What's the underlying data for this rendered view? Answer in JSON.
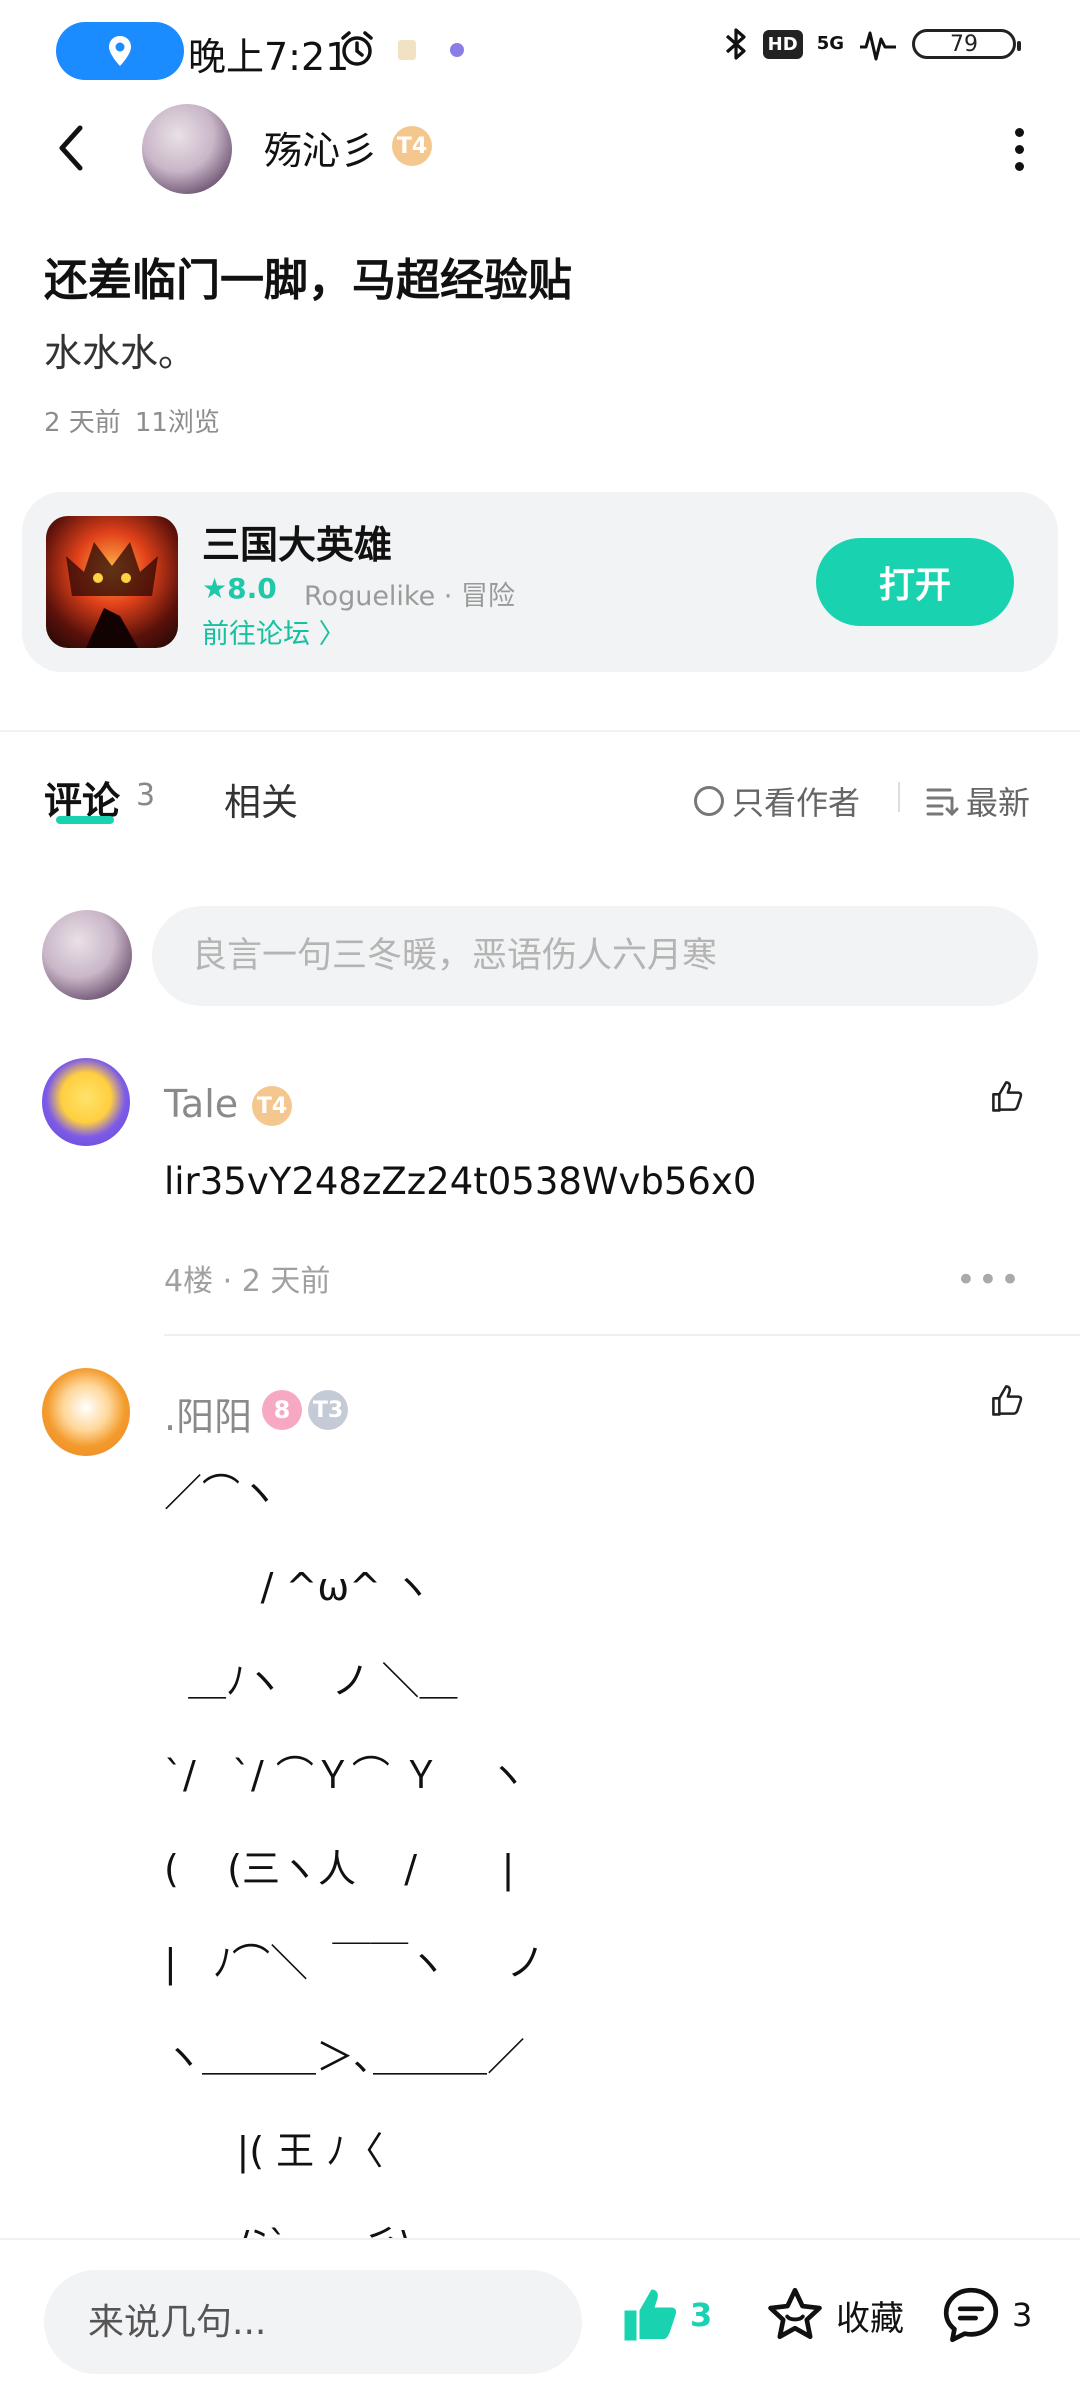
{
  "status_bar": {
    "time": "晚上7:21",
    "hd": "HD",
    "network": "5G",
    "battery": "79"
  },
  "header": {
    "author_name": "殇沁彡",
    "author_badge": "T4"
  },
  "post": {
    "title": "还差临门一脚，马超经验贴",
    "body": "水水水。",
    "time": "2 天前",
    "views": "11浏览"
  },
  "game": {
    "name": "三国大英雄",
    "rating": "★8.0",
    "tags": "Roguelike · 冒险",
    "forum_link": "前往论坛 〉",
    "open_label": "打开"
  },
  "tabs": {
    "comments_label": "评论",
    "comments_count": "3",
    "related_label": "相关",
    "author_only": "只看作者",
    "sort_latest": "最新"
  },
  "comment_box": {
    "placeholder": "良言一句三冬暖，恶语伤人六月寒"
  },
  "comments": [
    {
      "name": "Tale",
      "badge": "T4",
      "text": "lir35vY248zZz24t0538Wvb56x0",
      "meta": "4楼 · 2 天前"
    },
    {
      "name": ".阳阳",
      "badge_level": "8",
      "badge_t": "T3",
      "art_lines": [
        "／⌒ヽ",
        "        / ^ω^ ヽ",
        "  ＿ﾉヽ    ノ ＼＿",
        "`/   `/ ⌒Ｙ⌒ Ｙ    ヽ",
        "(    (三ヽ人    /       |",
        "|   ﾉ⌒＼  ￣￣ヽ     ノ",
        "ヽ＿＿＿＞､＿＿＿／",
        "      |( 王 ﾉ〈",
        "      /ﾐ`ー―彡\\"
      ]
    }
  ],
  "bottom_bar": {
    "input_placeholder": "来说几句...",
    "like_count": "3",
    "fav_label": "收藏",
    "comment_count": "3"
  },
  "colors": {
    "accent": "#19d3b0",
    "location_pill": "#1a8cff"
  }
}
